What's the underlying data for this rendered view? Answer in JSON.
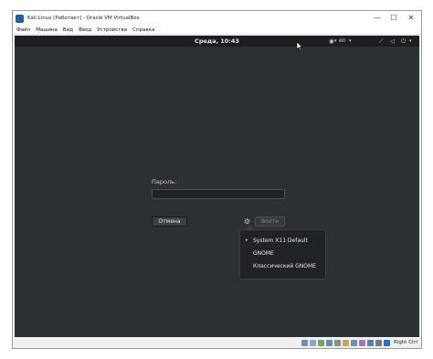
{
  "window": {
    "title": "Kali Linux [Работает] - Oracle VM VirtualBox",
    "minimize_icon": "minimize-icon",
    "maximize_icon": "maximize-icon",
    "close_icon": "close-icon"
  },
  "menubar": {
    "items": [
      "Файл",
      "Машина",
      "Вид",
      "Ввод",
      "Устройства",
      "Справка"
    ]
  },
  "vm": {
    "topbar": {
      "clock": "Среда, 10:43",
      "lang": "en",
      "icons": [
        "accessibility-icon",
        "input-source-icon",
        "network-icon",
        "volume-icon",
        "power-icon"
      ]
    },
    "login": {
      "password_label": "Пароль:",
      "password_value": "",
      "cancel_label": "Отмена",
      "login_label": "Войти",
      "session_icon": "gear-icon"
    },
    "session_menu": {
      "selected": "System X11 Default",
      "items": [
        "System X11 Default",
        "GNOME",
        "Классический GNOME"
      ]
    }
  },
  "statusbar": {
    "host_key": "Right Ctrl",
    "icons": [
      "hdd-icon",
      "optical-icon",
      "audio-icon",
      "network-icon",
      "usb-icon",
      "shared-folders-icon",
      "display-icon",
      "video-capture-icon",
      "cpu-icon",
      "mouse-integration-icon",
      "keyboard-icon"
    ]
  },
  "colors": {
    "vm_background": "#2c3033",
    "topbar": "#1c1e20",
    "popup": "#202325"
  }
}
